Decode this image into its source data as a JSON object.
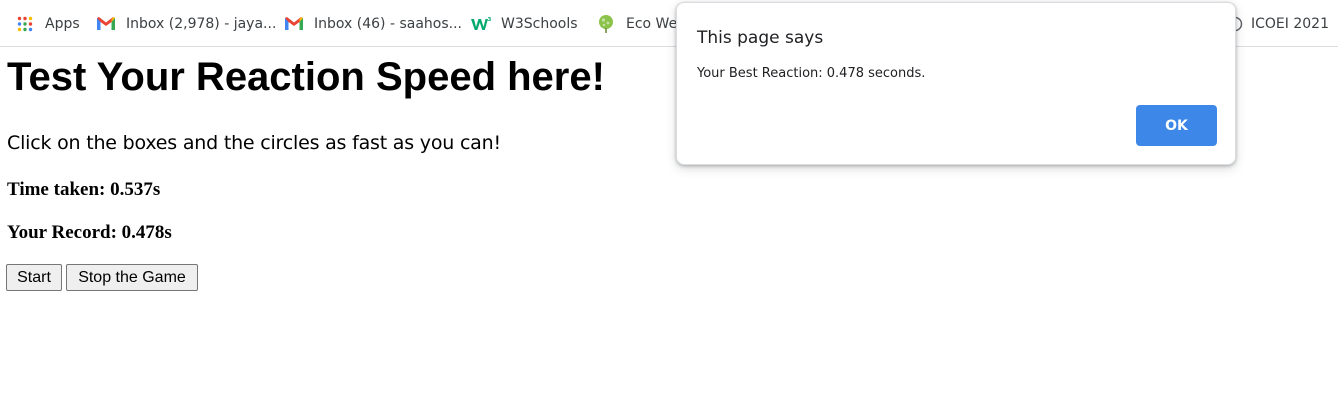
{
  "bookmarks": {
    "apps": {
      "label": "Apps",
      "icon": "apps-grid-icon"
    },
    "items": [
      {
        "label": "Inbox (2,978) - jaya...",
        "icon": "gmail-icon"
      },
      {
        "label": "Inbox (46) - saahos...",
        "icon": "gmail-icon"
      },
      {
        "label": "W3Schools",
        "icon": "w3schools-icon"
      },
      {
        "label": "Eco We",
        "icon": "eco-leaf-icon"
      },
      {
        "label": "ICOEI 2021",
        "icon": "site-icon"
      }
    ]
  },
  "page": {
    "title": "Test Your Reaction Speed here!",
    "instructions": "Click on the boxes and the circles as fast as you can!",
    "time_taken": "Time taken: 0.537s",
    "record": "Your Record: 0.478s",
    "start_label": "Start",
    "stop_label": "Stop the Game"
  },
  "dialog": {
    "title": "This page says",
    "message": "Your Best Reaction: 0.478 seconds.",
    "ok_label": "OK"
  },
  "colors": {
    "accent": "#3c87e8",
    "gmail_red": "#ea4335",
    "w3schools_green": "#04aa6d"
  }
}
